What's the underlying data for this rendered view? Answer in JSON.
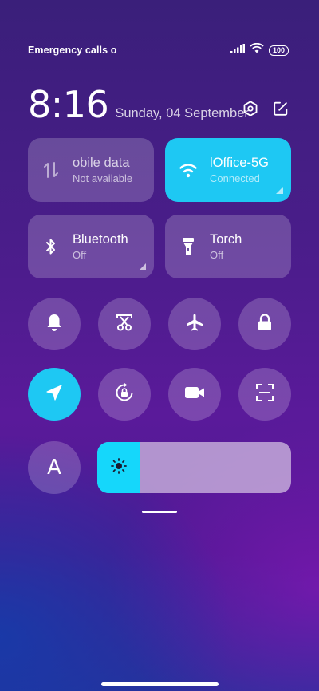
{
  "status_bar": {
    "carrier_text": "Emergency calls o",
    "battery_level": "100",
    "icons": [
      "signal-icon",
      "wifi-icon",
      "battery-icon"
    ]
  },
  "clock": {
    "time": "8:16",
    "date": "Sunday, 04 September"
  },
  "header_icons": [
    "settings-icon",
    "edit-icon"
  ],
  "tiles": {
    "mobile_data": {
      "label": "obile data",
      "status": "Not available",
      "active": false,
      "icon": "mobile-data-icon"
    },
    "wifi": {
      "label": "lOffice-5G",
      "status": "Connected",
      "active": true,
      "icon": "wifi-icon"
    },
    "bluetooth": {
      "label": "Bluetooth",
      "status": "Off",
      "active": false,
      "icon": "bluetooth-icon"
    },
    "torch": {
      "label": "Torch",
      "status": "Off",
      "active": false,
      "icon": "torch-icon"
    }
  },
  "toggles_row1": [
    {
      "name": "ringer-toggle",
      "icon": "bell-icon",
      "active": false
    },
    {
      "name": "screenshot-toggle",
      "icon": "scissors-icon",
      "active": false
    },
    {
      "name": "airplane-mode-toggle",
      "icon": "airplane-icon",
      "active": false
    },
    {
      "name": "lock-screen-toggle",
      "icon": "lock-icon",
      "active": false
    }
  ],
  "toggles_row2": [
    {
      "name": "location-toggle",
      "icon": "location-arrow-icon",
      "active": true
    },
    {
      "name": "auto-rotate-toggle",
      "icon": "rotate-lock-icon",
      "active": false
    },
    {
      "name": "screen-recorder-toggle",
      "icon": "video-camera-icon",
      "active": false
    },
    {
      "name": "scanner-toggle",
      "icon": "scan-icon",
      "active": false
    }
  ],
  "font_button": {
    "label": "A"
  },
  "brightness": {
    "level": 0.22,
    "icon": "sun-icon"
  },
  "colors": {
    "accent": "#1ec8f3",
    "tile_bg": "rgba(255,255,255,0.2)"
  }
}
